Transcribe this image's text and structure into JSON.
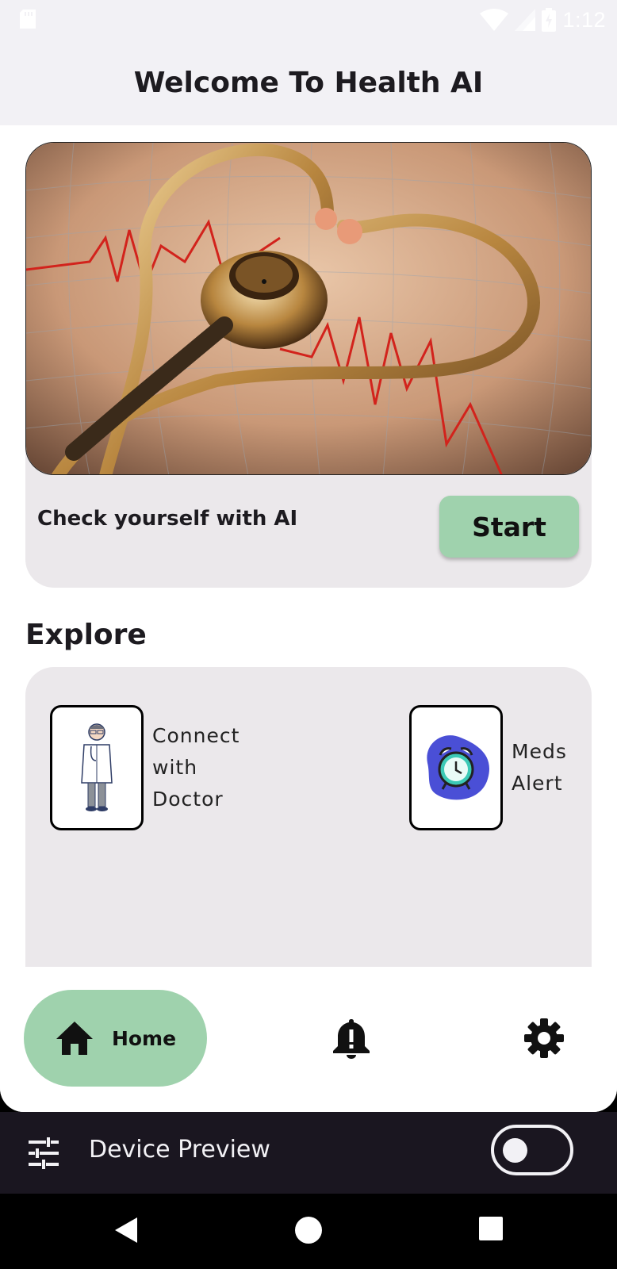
{
  "status_bar": {
    "time": "1:12",
    "icons": [
      "sd-card-icon",
      "wifi-icon",
      "signal-icon",
      "battery-charging-icon"
    ]
  },
  "header": {
    "title": "Welcome To Health AI"
  },
  "hero": {
    "image": "stethoscope-heart-image",
    "text": "Check yourself with AI",
    "button_label": "Start"
  },
  "explore": {
    "title": "Explore",
    "items": [
      {
        "label": "Connect with Doctor",
        "icon": "doctor-icon"
      },
      {
        "label": "Meds Alert",
        "icon": "alarm-clock-icon"
      }
    ]
  },
  "bottom_nav": {
    "items": [
      {
        "label": "Home",
        "icon": "home-icon",
        "selected": true
      },
      {
        "label": "",
        "icon": "bell-alert-icon",
        "selected": false
      },
      {
        "label": "",
        "icon": "gear-icon",
        "selected": false
      }
    ]
  },
  "device_preview": {
    "label": "Device Preview",
    "toggle_on": false
  },
  "colors": {
    "accent_green": "#9fd2ad",
    "card_gray": "#ebe8eb",
    "header_bg": "#f2f1f5",
    "preview_bar_bg": "#1a1620",
    "meds_blob": "#4a4fd6",
    "clock_teal": "#3cc9b6"
  }
}
